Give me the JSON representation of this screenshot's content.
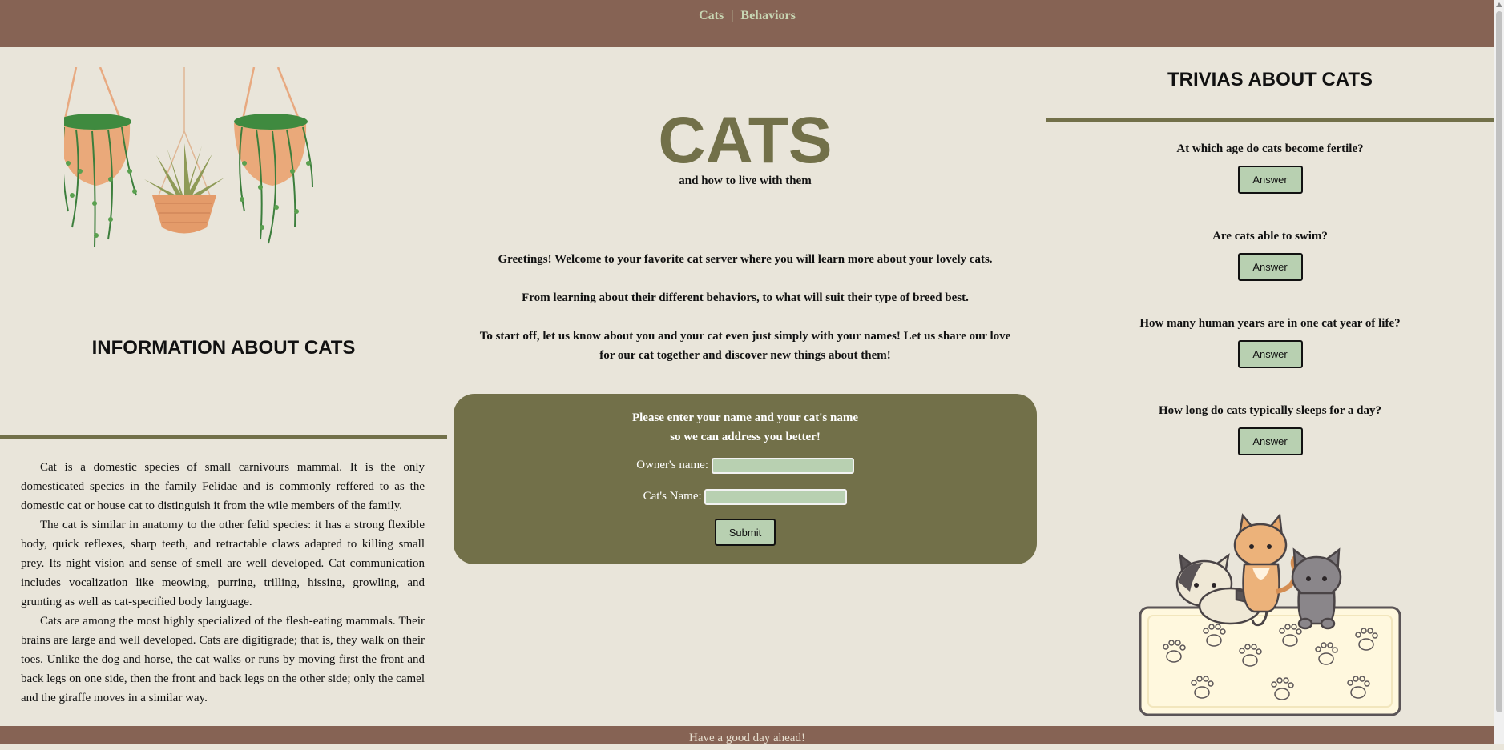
{
  "nav": {
    "links": [
      "Cats",
      "Behaviors"
    ],
    "separator": "|"
  },
  "left": {
    "heading": "INFORMATION ABOUT CATS",
    "paragraphs": [
      "Cat is a domestic species of small carnivours mammal. It is the only domesticated species in the family Felidae and is commonly reffered to as the domestic cat or house cat to distinguish it from the wile members of the family.",
      "The cat is similar in anatomy to the other felid species: it has a strong flexible body, quick reflexes, sharp teeth, and retractable claws adapted to killing small prey. Its night vision and sense of smell are well developed. Cat communication includes vocalization like meowing, purring, trilling, hissing, growling, and grunting as well as cat-specified body language.",
      "Cats are among the most highly specialized of the flesh-eating mammals. Their brains are large and well developed. Cats are digitigrade; that is, they walk on their toes. Unlike the dog and horse, the cat walks or runs by moving first the front and back legs on one side, then the front and back legs on the other side; only the camel and the giraffe moves in a similar way."
    ]
  },
  "center": {
    "title": "CATS",
    "tagline": "and how to live with them",
    "intro": [
      "Greetings! Welcome to your favorite cat server where you will learn more about your lovely cats.",
      "From learning about their different behaviors, to what will suit their type of breed best.",
      "To start off, let us know about you and your cat even just simply with your names! Let us share our love for our cat together and discover new things about them!"
    ],
    "form": {
      "prompt_line1": "Please enter your name and your cat's name",
      "prompt_line2": "so we can address you better!",
      "owner_label": "Owner's name:",
      "owner_value": "",
      "cat_label": "Cat's Name:",
      "cat_value": "",
      "submit_label": "Submit"
    }
  },
  "right": {
    "heading": "TRIVIAS ABOUT CATS",
    "questions": [
      {
        "question": "At which age do cats become fertile?",
        "button": "Answer"
      },
      {
        "question": "Are cats able to swim?",
        "button": "Answer"
      },
      {
        "question": "How many human years are in one cat year of life?",
        "button": "Answer"
      },
      {
        "question": "How long do cats typically sleeps for a day?",
        "button": "Answer"
      }
    ]
  },
  "footer": {
    "text": "Have a good day ahead!"
  },
  "colors": {
    "header": "#866354",
    "olive": "#727049",
    "background": "#e9e5da",
    "button": "#b8d0b1",
    "nav_link": "#c7d5b2"
  },
  "icons": {
    "plants_illustration": "hanging-plants-illustration",
    "cats_illustration": "cats-on-rug-illustration"
  }
}
